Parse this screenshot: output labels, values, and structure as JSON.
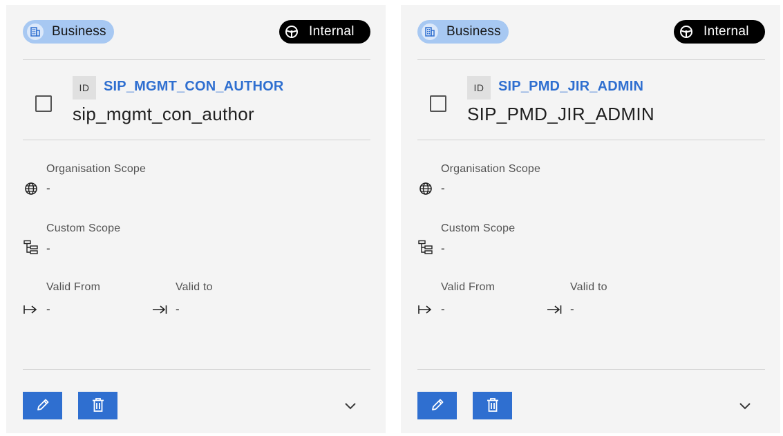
{
  "cards": [
    {
      "category_badge": {
        "label": "Business",
        "icon": "building-icon"
      },
      "scope_badge": {
        "label": "Internal",
        "icon": "steering-wheel-icon"
      },
      "id_tag": "ID",
      "id": "SIP_MGMT_CON_AUTHOR",
      "name": "sip_mgmt_con_author",
      "fields": {
        "org_scope": {
          "label": "Organisation Scope",
          "value": "-"
        },
        "custom_scope": {
          "label": "Custom Scope",
          "value": "-"
        },
        "valid_from": {
          "label": "Valid From",
          "value": "-"
        },
        "valid_to": {
          "label": "Valid to",
          "value": "-"
        }
      }
    },
    {
      "category_badge": {
        "label": "Business",
        "icon": "building-icon"
      },
      "scope_badge": {
        "label": "Internal",
        "icon": "steering-wheel-icon"
      },
      "id_tag": "ID",
      "id": "SIP_PMD_JIR_ADMIN",
      "name": "SIP_PMD_JIR_ADMIN",
      "fields": {
        "org_scope": {
          "label": "Organisation Scope",
          "value": "-"
        },
        "custom_scope": {
          "label": "Custom Scope",
          "value": "-"
        },
        "valid_from": {
          "label": "Valid From",
          "value": "-"
        },
        "valid_to": {
          "label": "Valid to",
          "value": "-"
        }
      }
    }
  ],
  "colors": {
    "card_bg": "#f4f4f4",
    "primary_blue": "#2f6fd0",
    "business_badge_bg": "#a7c8f2",
    "internal_badge_bg": "#000000",
    "divider": "#cfcfcf"
  }
}
